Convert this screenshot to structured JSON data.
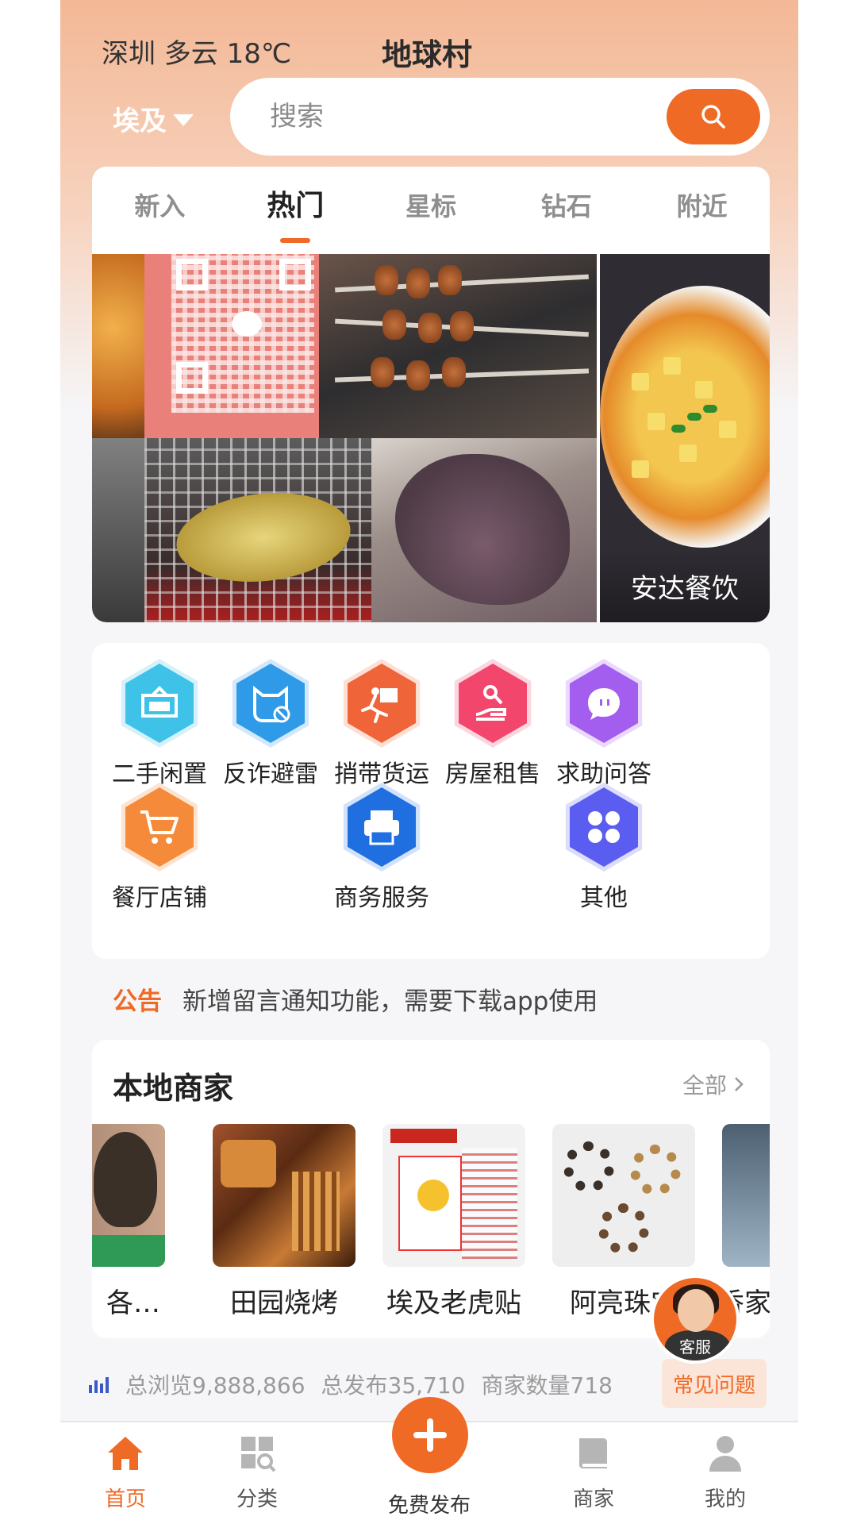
{
  "header": {
    "weather": "深圳  多云  18℃",
    "title": "地球村",
    "region": "埃及"
  },
  "search": {
    "placeholder": "搜索",
    "icon": "search-icon"
  },
  "tabs": [
    {
      "label": "新入",
      "active": false
    },
    {
      "label": "热门",
      "active": true
    },
    {
      "label": "星标",
      "active": false
    },
    {
      "label": "钻石",
      "active": false
    },
    {
      "label": "附近",
      "active": false
    }
  ],
  "banner": {
    "side_caption": "安达餐饮"
  },
  "categories": [
    {
      "label": "二手闲置",
      "icon": "secondhand-icon",
      "color": "#3ec2e8"
    },
    {
      "label": "反诈避雷",
      "icon": "anti-fraud-icon",
      "color": "#2f9be8"
    },
    {
      "label": "捎带货运",
      "icon": "delivery-runner-icon",
      "color": "#f0643a"
    },
    {
      "label": "房屋租售",
      "icon": "house-rent-icon",
      "color": "#f2466c"
    },
    {
      "label": "求助问答",
      "icon": "chat-bubble-icon",
      "color": "#a35ef0"
    },
    {
      "label": "餐厅店铺",
      "icon": "shopping-cart-icon",
      "color": "#f58a3a"
    },
    {
      "label": "商务服务",
      "icon": "printer-icon",
      "color": "#1f6fe0"
    },
    {
      "label": "其他",
      "icon": "more-grid-icon",
      "color": "#5b5df0"
    }
  ],
  "notice": {
    "tag": "公告",
    "text": "新增留言通知功能，需要下载app使用"
  },
  "merchants": {
    "title": "本地商家",
    "all_label": "全部",
    "items": [
      {
        "name": "各…"
      },
      {
        "name": "田园烧烤"
      },
      {
        "name": "埃及老虎贴"
      },
      {
        "name": "阿亮珠宝"
      },
      {
        "name": "香家"
      }
    ]
  },
  "stats": {
    "views": "总浏览9,888,866",
    "posts": "总发布35,710",
    "merchants": "商家数量718"
  },
  "faq": {
    "label": "常见问题"
  },
  "customer_service": {
    "label": "客服"
  },
  "bottom_nav": [
    {
      "label": "首页",
      "icon": "home-icon",
      "active": true
    },
    {
      "label": "分类",
      "icon": "category-icon",
      "active": false
    },
    {
      "label": "免费发布",
      "icon": "plus-icon",
      "active": false
    },
    {
      "label": "商家",
      "icon": "book-icon",
      "active": false
    },
    {
      "label": "我的",
      "icon": "user-icon",
      "active": false
    }
  ],
  "colors": {
    "accent": "#ef6a25",
    "header_gradient_top": "#f3b896"
  }
}
